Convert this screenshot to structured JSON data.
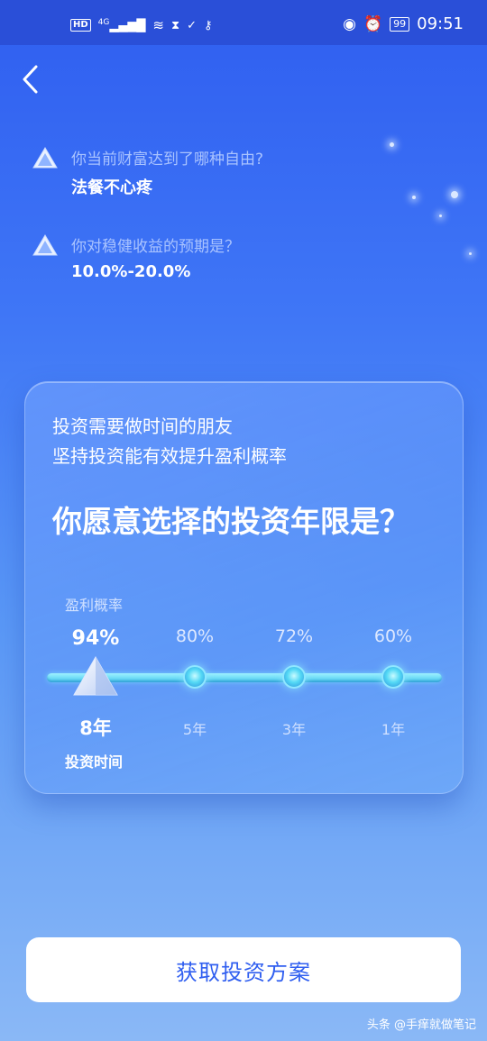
{
  "status_bar": {
    "hd": "HD",
    "network": "4G",
    "battery": "99",
    "time": "09:51"
  },
  "questions": [
    {
      "question": "你当前财富达到了哪种自由?",
      "answer": "法餐不心疼"
    },
    {
      "question": "你对稳健收益的预期是？",
      "answer": "10.0%-20.0%"
    }
  ],
  "card": {
    "subtitle_1": "投资需要做时间的朋友",
    "subtitle_2": "坚持投资能有效提升盈利概率",
    "title": "你愿意选择的投资年限是？",
    "probability_label": "盈利概率",
    "time_label": "投资时间",
    "options": [
      {
        "pct": "94%",
        "years": "8年",
        "selected": true
      },
      {
        "pct": "80%",
        "years": "5年",
        "selected": false
      },
      {
        "pct": "72%",
        "years": "3年",
        "selected": false
      },
      {
        "pct": "60%",
        "years": "1年",
        "selected": false
      }
    ]
  },
  "cta_label": "获取投资方案",
  "watermark": "头条 @手痒就做笔记",
  "colors": {
    "accent": "#2f5ef0",
    "status_bar": "#2a4fd8",
    "track": "#45c9ee"
  }
}
